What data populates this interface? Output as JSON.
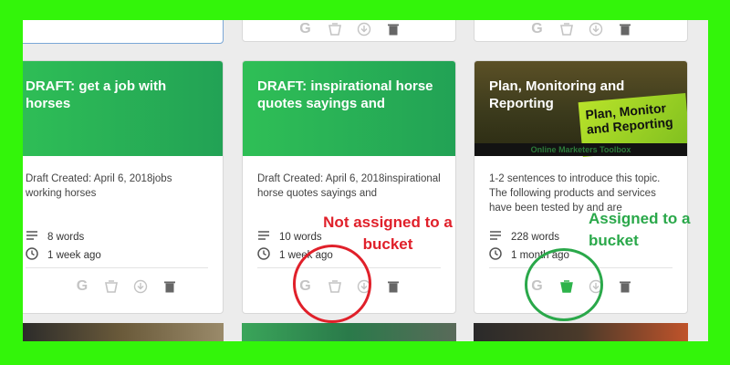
{
  "cards": [
    {
      "title": "DRAFT: get a job with horses",
      "description": "Draft Created: April 6, 2018jobs working horses",
      "words": "8 words",
      "age": "1 week ago"
    },
    {
      "title": "DRAFT: inspirational horse quotes sayings and",
      "description": "Draft Created: April 6, 2018inspirational horse quotes sayings and",
      "words": "10 words",
      "age": "1 week ago"
    },
    {
      "title": "Plan, Monitoring and Reporting",
      "image_text": "Plan, Monitor and Reporting",
      "image_band": "Online Marketers Toolbox",
      "description": "1-2 sentences to introduce this topic. The following products and services have been tested by and are",
      "words": "228 words",
      "age": "1 month ago"
    }
  ],
  "action_labels": {
    "google": "G"
  },
  "annotations": {
    "not_assigned": "Not assigned to a bucket",
    "assigned": "Assigned to a bucket"
  },
  "colors": {
    "frame": "#33f50a",
    "card_header": "#2fbf56",
    "annotation_red": "#e0202a",
    "annotation_green": "#2aa84a",
    "bucket_assigned": "#2db34a",
    "icon_gray": "#c4c4c4"
  }
}
